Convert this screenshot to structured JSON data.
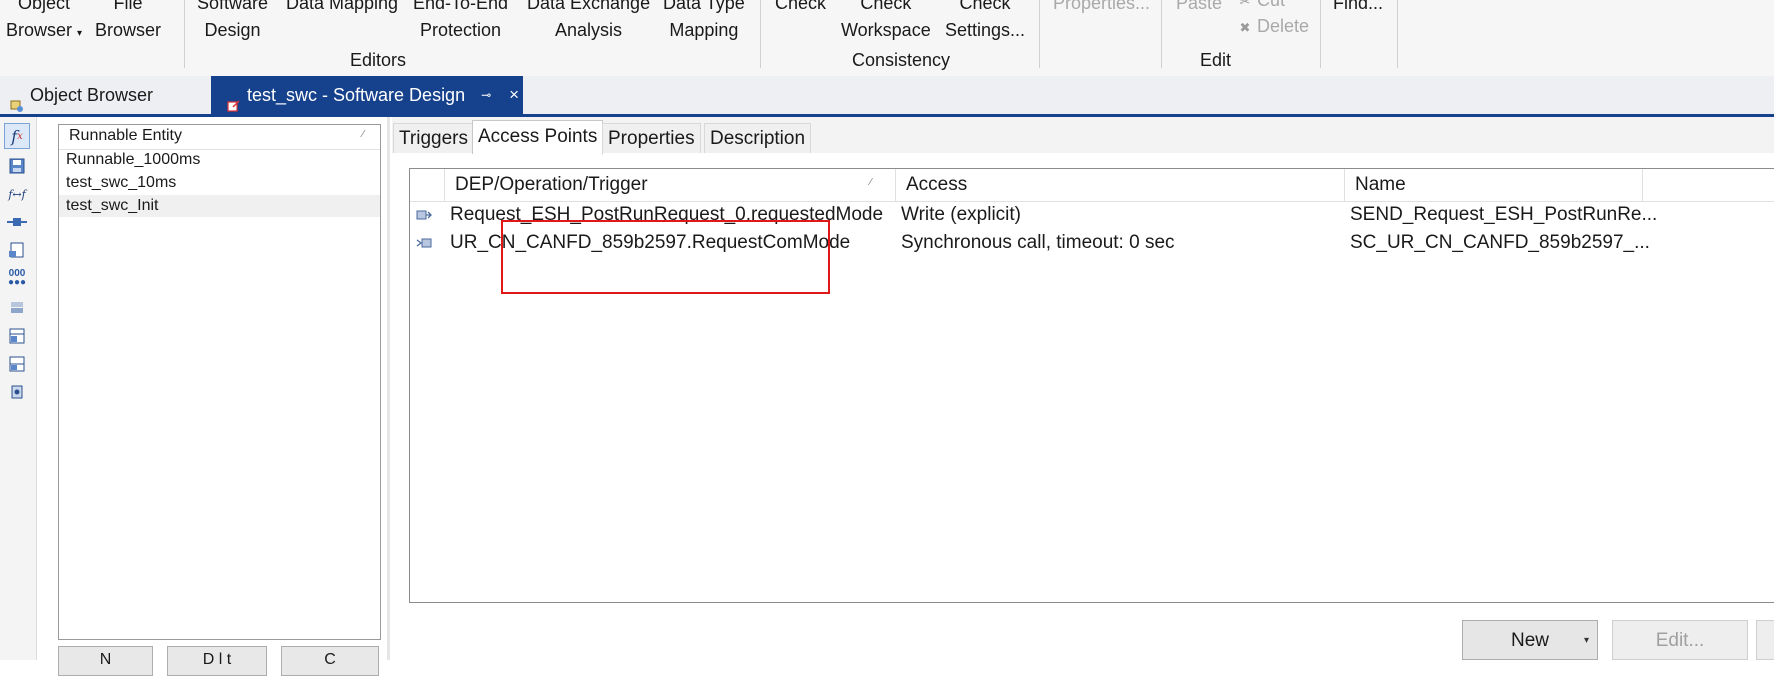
{
  "ribbon": {
    "buttons": [
      {
        "id": "object-browser",
        "lines": [
          "Object",
          "Browser"
        ],
        "dropdown": true
      },
      {
        "id": "file-browser",
        "lines": [
          "File",
          "Browser"
        ]
      },
      {
        "id": "software-design",
        "lines": [
          "Software",
          "Design"
        ]
      },
      {
        "id": "data-mapping",
        "lines": [
          "Data Mapping",
          ""
        ]
      },
      {
        "id": "end-to-end-protection",
        "lines": [
          "End-To-End",
          "Protection"
        ]
      },
      {
        "id": "data-exchange-analysis",
        "lines": [
          "Data Exchange",
          "Analysis"
        ]
      },
      {
        "id": "data-type-mapping",
        "lines": [
          "Data Type",
          "Mapping"
        ]
      },
      {
        "id": "check",
        "lines": [
          "Check",
          ""
        ]
      },
      {
        "id": "check-workspace",
        "lines": [
          "Check",
          "Workspace"
        ]
      },
      {
        "id": "check-settings",
        "lines": [
          "Check",
          "Settings..."
        ]
      },
      {
        "id": "properties",
        "lines": [
          "Properties...",
          ""
        ],
        "disabled": true
      },
      {
        "id": "paste",
        "lines": [
          "Paste",
          ""
        ],
        "disabled": true
      },
      {
        "id": "find",
        "lines": [
          "Find...",
          ""
        ]
      }
    ],
    "small_commands": {
      "cut": "Cut",
      "delete": "Delete"
    },
    "groups": {
      "editors": "Editors",
      "consistency": "Consistency",
      "edit": "Edit"
    }
  },
  "doc_tabs": {
    "object_browser": "Object Browser",
    "software_design": "test_swc - Software Design"
  },
  "runnables": {
    "header": "Runnable Entity",
    "items": [
      "Runnable_1000ms",
      "test_swc_10ms",
      "test_swc_Init"
    ],
    "selected_index": 2,
    "buttons": [
      "N",
      "D l t",
      "C"
    ]
  },
  "sub_tabs": {
    "tabs": [
      "Triggers",
      "Access Points",
      "Properties",
      "Description"
    ],
    "active": "Access Points"
  },
  "access_points": {
    "columns": [
      "DEP/Operation/Trigger",
      "Access",
      "Name"
    ],
    "rows": [
      {
        "trigger": "Request_ESH_PostRunRequest_0.requestedMode",
        "access": "Write (explicit)",
        "name": "SEND_Request_ESH_PostRunRe..."
      },
      {
        "trigger": "UR_CN_CANFD_859b2597.RequestComMode",
        "access": "Synchronous call, timeout: 0 sec",
        "name": "SC_UR_CN_CANFD_859b2597_..."
      }
    ]
  },
  "footer_buttons": {
    "new": "New",
    "edit": "Edit..."
  },
  "colors": {
    "accent": "#16418c",
    "highlight": "#e01818"
  }
}
